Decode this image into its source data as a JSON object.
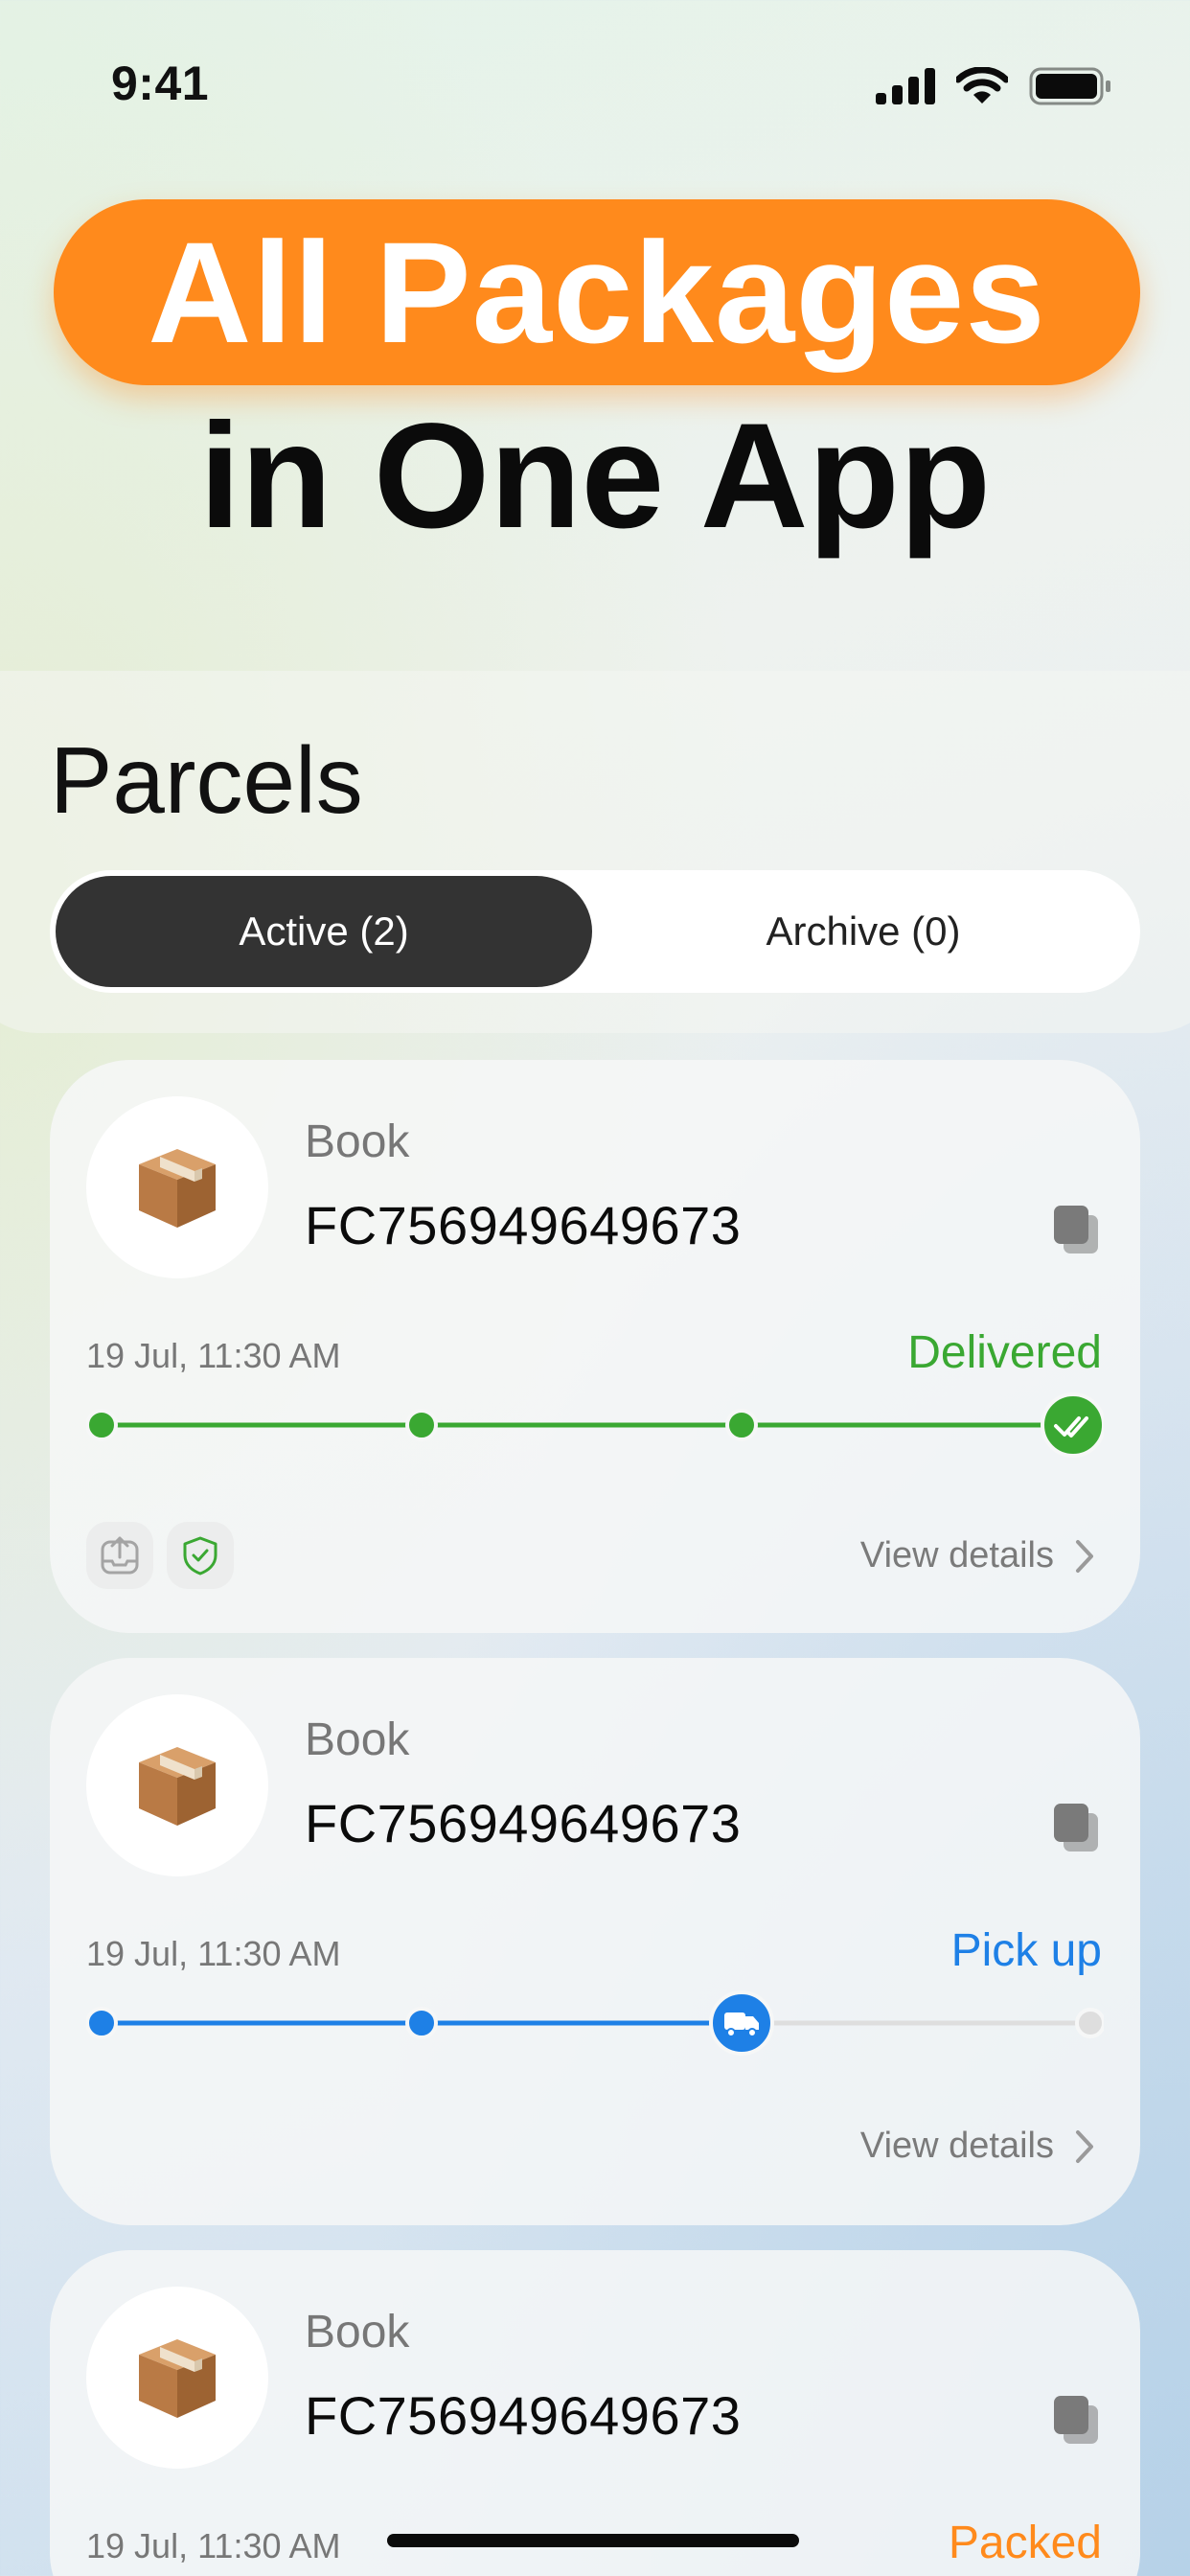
{
  "status_bar": {
    "time": "9:41",
    "icons": [
      "signal-icon",
      "wifi-icon",
      "battery-icon"
    ]
  },
  "hero": {
    "line1": "All Packages",
    "line2": "in One App",
    "accent_color": "#ff8a1c"
  },
  "parcels": {
    "title": "Parcels",
    "tabs": [
      {
        "label": "Active (2)",
        "selected": true
      },
      {
        "label": "Archive (0)",
        "selected": false
      }
    ],
    "cards": [
      {
        "name": "Book",
        "tracking": "FC756949649673",
        "date": "19 Jul, 11:30 AM",
        "status": "Delivered",
        "status_color": "#3aa832",
        "progress_stage": "delivered",
        "view_label": "View details"
      },
      {
        "name": "Book",
        "tracking": "FC756949649673",
        "date": "19 Jul, 11:30 AM",
        "status": "Pick up",
        "status_color": "#1e80e6",
        "progress_stage": "in_transit",
        "view_label": "View details"
      },
      {
        "name": "Book",
        "tracking": "FC756949649673",
        "date": "19 Jul, 11:30 AM",
        "status": "Packed",
        "status_color": "#ff8a1c",
        "progress_stage": "packed"
      }
    ]
  }
}
